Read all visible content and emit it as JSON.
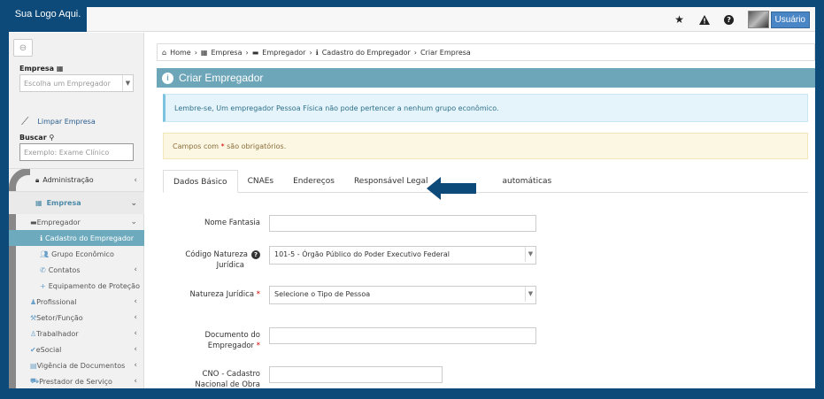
{
  "header": {
    "logo": "Sua Logo Aqui.",
    "icons": [
      "star-icon",
      "warning-icon",
      "help-icon"
    ],
    "user_label": "Usuário"
  },
  "sidebar": {
    "empresa_label": "Empresa",
    "empresa_placeholder": "Escolha um Empregador",
    "clear_label": "Limpar Empresa",
    "search_label": "Buscar",
    "search_placeholder": "Exemplo: Exame Clínico",
    "menu": [
      {
        "label": "Administração",
        "type": "section"
      },
      {
        "label": "Empresa",
        "type": "section-open"
      },
      {
        "label": "Empregador",
        "type": "group"
      },
      {
        "label": "Cadastro do Empregador",
        "type": "active"
      },
      {
        "label": "Grupo Econômico",
        "type": "item"
      },
      {
        "label": "Contatos",
        "type": "item"
      },
      {
        "label": "Equipamento de Proteção",
        "type": "item"
      },
      {
        "label": "Profissional",
        "type": "group"
      },
      {
        "label": "Setor/Função",
        "type": "group"
      },
      {
        "label": "Trabalhador",
        "type": "group"
      },
      {
        "label": "eSocial",
        "type": "group"
      },
      {
        "label": "Vigência de Documentos",
        "type": "group"
      },
      {
        "label": "Prestador de Serviço",
        "type": "group"
      }
    ]
  },
  "breadcrumb": [
    "Home",
    "Empresa",
    "Empregador",
    "Cadastro do Empregador",
    "Criar Empresa"
  ],
  "panel": {
    "title": "Criar Empregador",
    "info_alert": "Lembre-se, Um empregador Pessoa Física não pode pertencer a nenhum grupo econômico.",
    "warn_alert_pre": "Campos com ",
    "warn_alert_star": "*",
    "warn_alert_post": " são obrigatórios."
  },
  "tabs": [
    "Dados Básico",
    "CNAEs",
    "Endereços",
    "Responsável Legal",
    "automáticas"
  ],
  "form": {
    "nome_fantasia_label": "Nome Fantasia",
    "nome_fantasia_value": "",
    "natureza_codigo_label_1": "Código Natureza",
    "natureza_codigo_label_2": "Jurídica",
    "natureza_codigo_value": "101-5 - Órgão Público do Poder Executivo Federal",
    "natureza_juridica_label": "Natureza Jurídica",
    "natureza_juridica_value": "Selecione o Tipo de Pessoa",
    "documento_label_1": "Documento do",
    "documento_label_2": "Empregador",
    "cno_label_1": "CNO - Cadastro",
    "cno_label_2": "Nacional de Obra",
    "required_mark": "*"
  },
  "colors": {
    "brand": "#0d4a7a",
    "panel_header": "#6da5b9",
    "active_menu": "#6eaabd",
    "user_button": "#4a86c5"
  }
}
